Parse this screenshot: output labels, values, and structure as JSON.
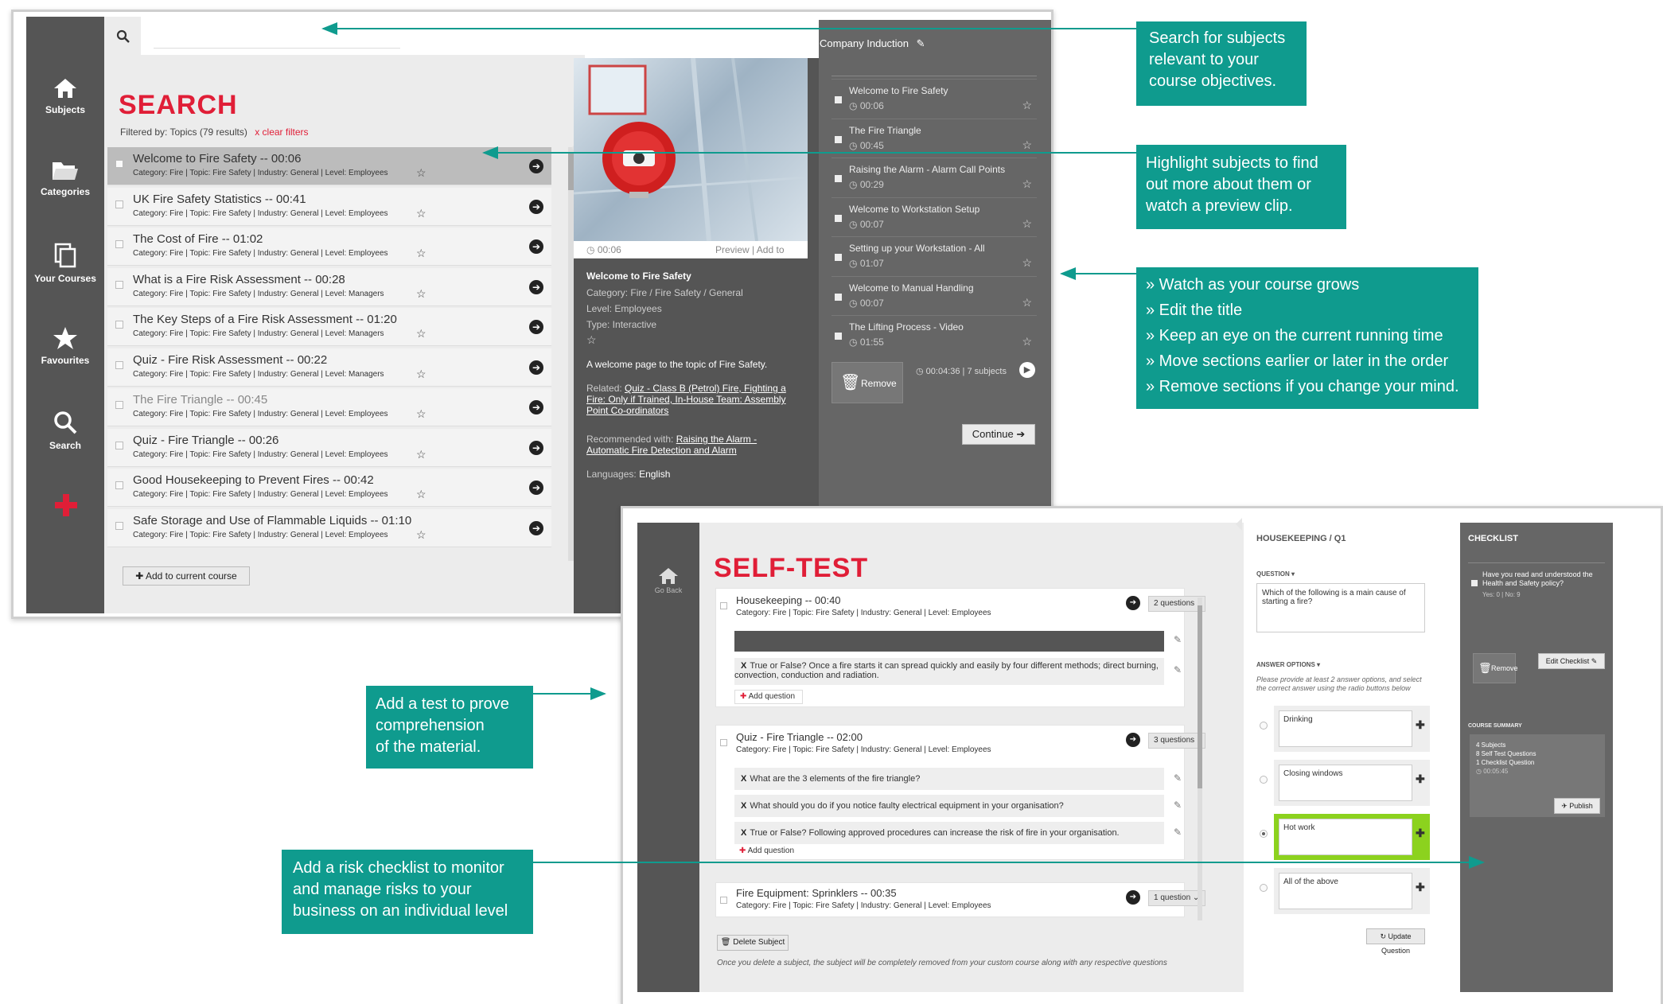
{
  "search_window": {
    "nav": [
      {
        "label": "Subjects",
        "icon": "home-icon"
      },
      {
        "label": "Categories",
        "icon": "folder-icon"
      },
      {
        "label": "Your Courses",
        "icon": "copy-icon"
      },
      {
        "label": "Favourites",
        "icon": "star-icon"
      },
      {
        "label": "Search",
        "icon": "search-icon"
      }
    ],
    "title": "SEARCH",
    "filter_text": "Filtered by: Topics (79 results)",
    "clear_filters": "x clear filters",
    "results": [
      {
        "title": "Welcome to Fire Safety -- 00:06",
        "meta": "Category: Fire | Topic: Fire Safety | Industry: General | Level: Employees",
        "selected": true
      },
      {
        "title": "UK Fire Safety Statistics -- 00:41",
        "meta": "Category: Fire | Topic: Fire Safety | Industry: General | Level: Employees"
      },
      {
        "title": "The Cost of Fire -- 01:02",
        "meta": "Category: Fire | Topic: Fire Safety | Industry: General | Level: Employees"
      },
      {
        "title": "What is a Fire Risk Assessment -- 00:28",
        "meta": "Category: Fire | Topic: Fire Safety | Industry: General | Level: Managers"
      },
      {
        "title": "The Key Steps of a Fire Risk Assessment -- 01:20",
        "meta": "Category: Fire | Topic: Fire Safety | Industry: General | Level: Managers"
      },
      {
        "title": "Quiz - Fire Risk Assessment -- 00:22",
        "meta": "Category: Fire | Topic: Fire Safety | Industry: General | Level: Managers"
      },
      {
        "title": "The Fire Triangle -- 00:45",
        "meta": "Category: Fire | Topic: Fire Safety | Industry: General | Level: Employees",
        "dim": true
      },
      {
        "title": "Quiz - Fire Triangle -- 00:26",
        "meta": "Category: Fire | Topic: Fire Safety | Industry: General | Level: Employees"
      },
      {
        "title": "Good Housekeeping to Prevent Fires -- 00:42",
        "meta": "Category: Fire | Topic: Fire Safety | Industry: General | Level: Employees"
      },
      {
        "title": "Safe Storage and Use of Flammable Liquids -- 01:10",
        "meta": "Category: Fire | Topic: Fire Safety | Industry: General | Level: Employees"
      }
    ],
    "add_button": "Add to current course",
    "preview": {
      "time": "00:06",
      "links": "Preview | Add to",
      "title": "Welcome to Fire Safety",
      "category": "Category: Fire / Fire Safety / General",
      "level": "Level: Employees",
      "type": "Type: Interactive",
      "description": "A welcome page to the topic of Fire Safety.",
      "related_label": "Related:",
      "related_links": "Quiz - Class B (Petrol) Fire, Fighting a Fire: Only if Trained, In-House Team: Assembly Point Co-ordinators",
      "recommended_label": "Recommended with:",
      "recommended_links": "Raising the Alarm - Automatic Fire Detection and Alarm",
      "languages_label": "Languages:",
      "languages": "English"
    },
    "course": {
      "title": "Company Induction",
      "items": [
        {
          "title": "Welcome to Fire Safety",
          "duration": "00:06"
        },
        {
          "title": "The Fire Triangle",
          "duration": "00:45"
        },
        {
          "title": "Raising the Alarm - Alarm Call Points",
          "duration": "00:29"
        },
        {
          "title": "Welcome to Workstation Setup",
          "duration": "00:07"
        },
        {
          "title": "Setting up your Workstation - All",
          "duration": "01:07"
        },
        {
          "title": "Welcome to Manual Handling",
          "duration": "00:07"
        },
        {
          "title": "The Lifting Process - Video",
          "duration": "01:55"
        }
      ],
      "remove": "Remove",
      "summary": "00:04:36 | 7 subjects",
      "continue": "Continue"
    }
  },
  "callouts": {
    "search": [
      "Search for subjects",
      "relevant to your",
      "course objectives."
    ],
    "highlight": [
      "Highlight subjects to find",
      "out more about them or",
      "watch a preview clip."
    ],
    "course": [
      "» Watch as your course grows",
      "» Edit the title",
      "» Keep an eye on the current running time",
      "» Move sections earlier or later in the order",
      "» Remove sections if you change your mind."
    ],
    "test": [
      "Add a test to prove",
      "comprehension",
      "of the material."
    ],
    "checklist": [
      "Add a risk checklist to monitor",
      "and manage risks to your",
      "business on an individual level"
    ]
  },
  "selftest_window": {
    "go_back": "Go Back",
    "title": "SELF-TEST",
    "subjects": [
      {
        "title": "Housekeeping -- 00:40",
        "meta": "Category: Fire | Topic: Fire Safety | Industry: General | Level: Employees",
        "count": "2 questions",
        "questions": [
          "True or False? Once a fire starts it can spread quickly and easily by four different methods; direct burning, convection, conduction and radiation."
        ]
      },
      {
        "title": "Quiz - Fire Triangle -- 02:00",
        "meta": "Category: Fire | Topic: Fire Safety | Industry: General | Level: Employees",
        "count": "3 questions",
        "questions": [
          "What are the 3 elements of the fire triangle?",
          "What should you do if you notice faulty electrical equipment in your organisation?",
          "True or False? Following approved procedures can increase the risk of fire in your organisation."
        ]
      },
      {
        "title": "Fire Equipment: Sprinklers -- 00:35",
        "meta": "Category: Fire | Topic: Fire Safety | Industry: General | Level: Employees",
        "count": "1 question"
      }
    ],
    "x_mark": "X",
    "add_question": "Add question",
    "delete_subject": "Delete Subject",
    "delete_note": "Once you delete a subject, the subject will be completely removed from your custom course along with any respective questions",
    "editor": {
      "heading": "HOUSEKEEPING / Q1",
      "question_label": "QUESTION ▾",
      "question": "Which of the following is a main cause of starting a fire?",
      "answers_label": "ANSWER OPTIONS ▾",
      "answers_help": "Please provide at least 2 answer options, and select the correct answer using the radio buttons below",
      "answers": [
        "Drinking",
        "Closing windows",
        "Hot work",
        "All of the above"
      ],
      "correct_index": 2,
      "update": "Update Question"
    },
    "checklist": {
      "heading": "CHECKLIST",
      "item": "Have you read and understood the Health and Safety policy?",
      "item_meta": "Yes: 0 | No: 9",
      "remove": "Remove",
      "edit": "Edit Checklist",
      "summary_label": "COURSE SUMMARY",
      "summary": [
        "4 Subjects",
        "8 Self Test Questions",
        "1 Checklist Question",
        "00:05:45"
      ],
      "publish": "Publish"
    }
  },
  "colors": {
    "accent_red": "#e01e37",
    "teal": "#0f9b8e",
    "dark_panel": "#555555",
    "highlight_green": "#8cd21e"
  }
}
